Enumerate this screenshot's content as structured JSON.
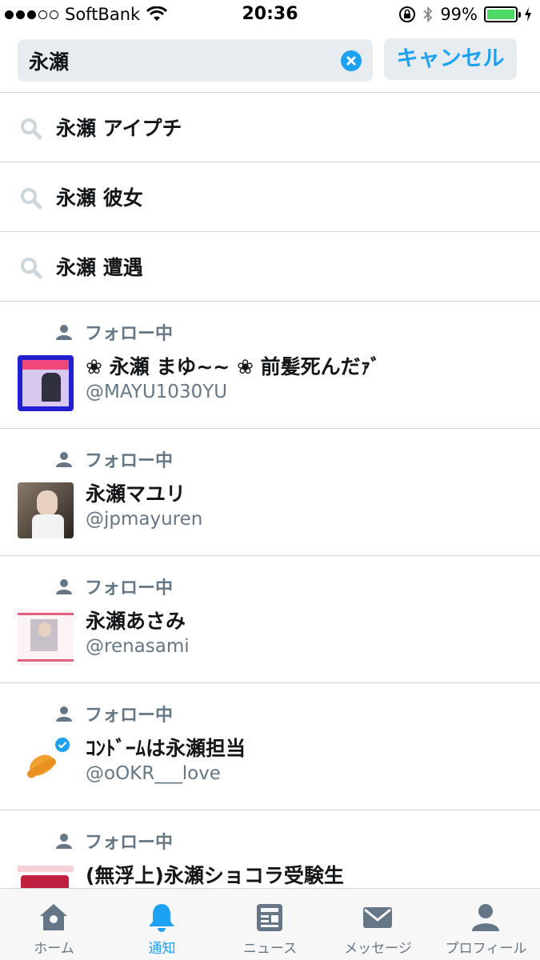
{
  "status_bar": {
    "signal": [
      true,
      true,
      true,
      false,
      false
    ],
    "carrier": "SoftBank",
    "time": "20:36",
    "battery_percent": "99%",
    "battery_level": 0.99
  },
  "search": {
    "query": "永瀬",
    "cancel_label": "キャンセル"
  },
  "suggestions": [
    {
      "text": "永瀬 アイプチ"
    },
    {
      "text": "永瀬 彼女"
    },
    {
      "text": "永瀬 遭遇"
    }
  ],
  "users": [
    {
      "follow_label": "フォロー中",
      "name": "❀ 永瀬  まゆ~~ ❀ 前髪死んだｧﾞ",
      "handle": "@MAYU1030YU"
    },
    {
      "follow_label": "フォロー中",
      "name": "永瀬マユリ",
      "handle": "@jpmayuren"
    },
    {
      "follow_label": "フォロー中",
      "name": "永瀬あさみ",
      "handle": "@renasami"
    },
    {
      "follow_label": "フォロー中",
      "name": "ｺﾝﾄﾞｰﾑは永瀬担当",
      "handle": "@oOKR___love"
    },
    {
      "follow_label": "フォロー中",
      "name": "(無浮上)永瀬ショコラ受験生",
      "handle": ""
    }
  ],
  "tab_bar": {
    "tabs": [
      {
        "label": "ホーム",
        "icon": "home-icon"
      },
      {
        "label": "通知",
        "icon": "bell-icon"
      },
      {
        "label": "ニュース",
        "icon": "news-icon"
      },
      {
        "label": "メッセージ",
        "icon": "envelope-icon"
      },
      {
        "label": "プロフィール",
        "icon": "person-icon"
      }
    ],
    "active": "通知"
  },
  "colors": {
    "accent": "#1da1f2",
    "secondary_text": "#657786",
    "divider": "#ccd6dd",
    "battery": "#4cd964"
  }
}
